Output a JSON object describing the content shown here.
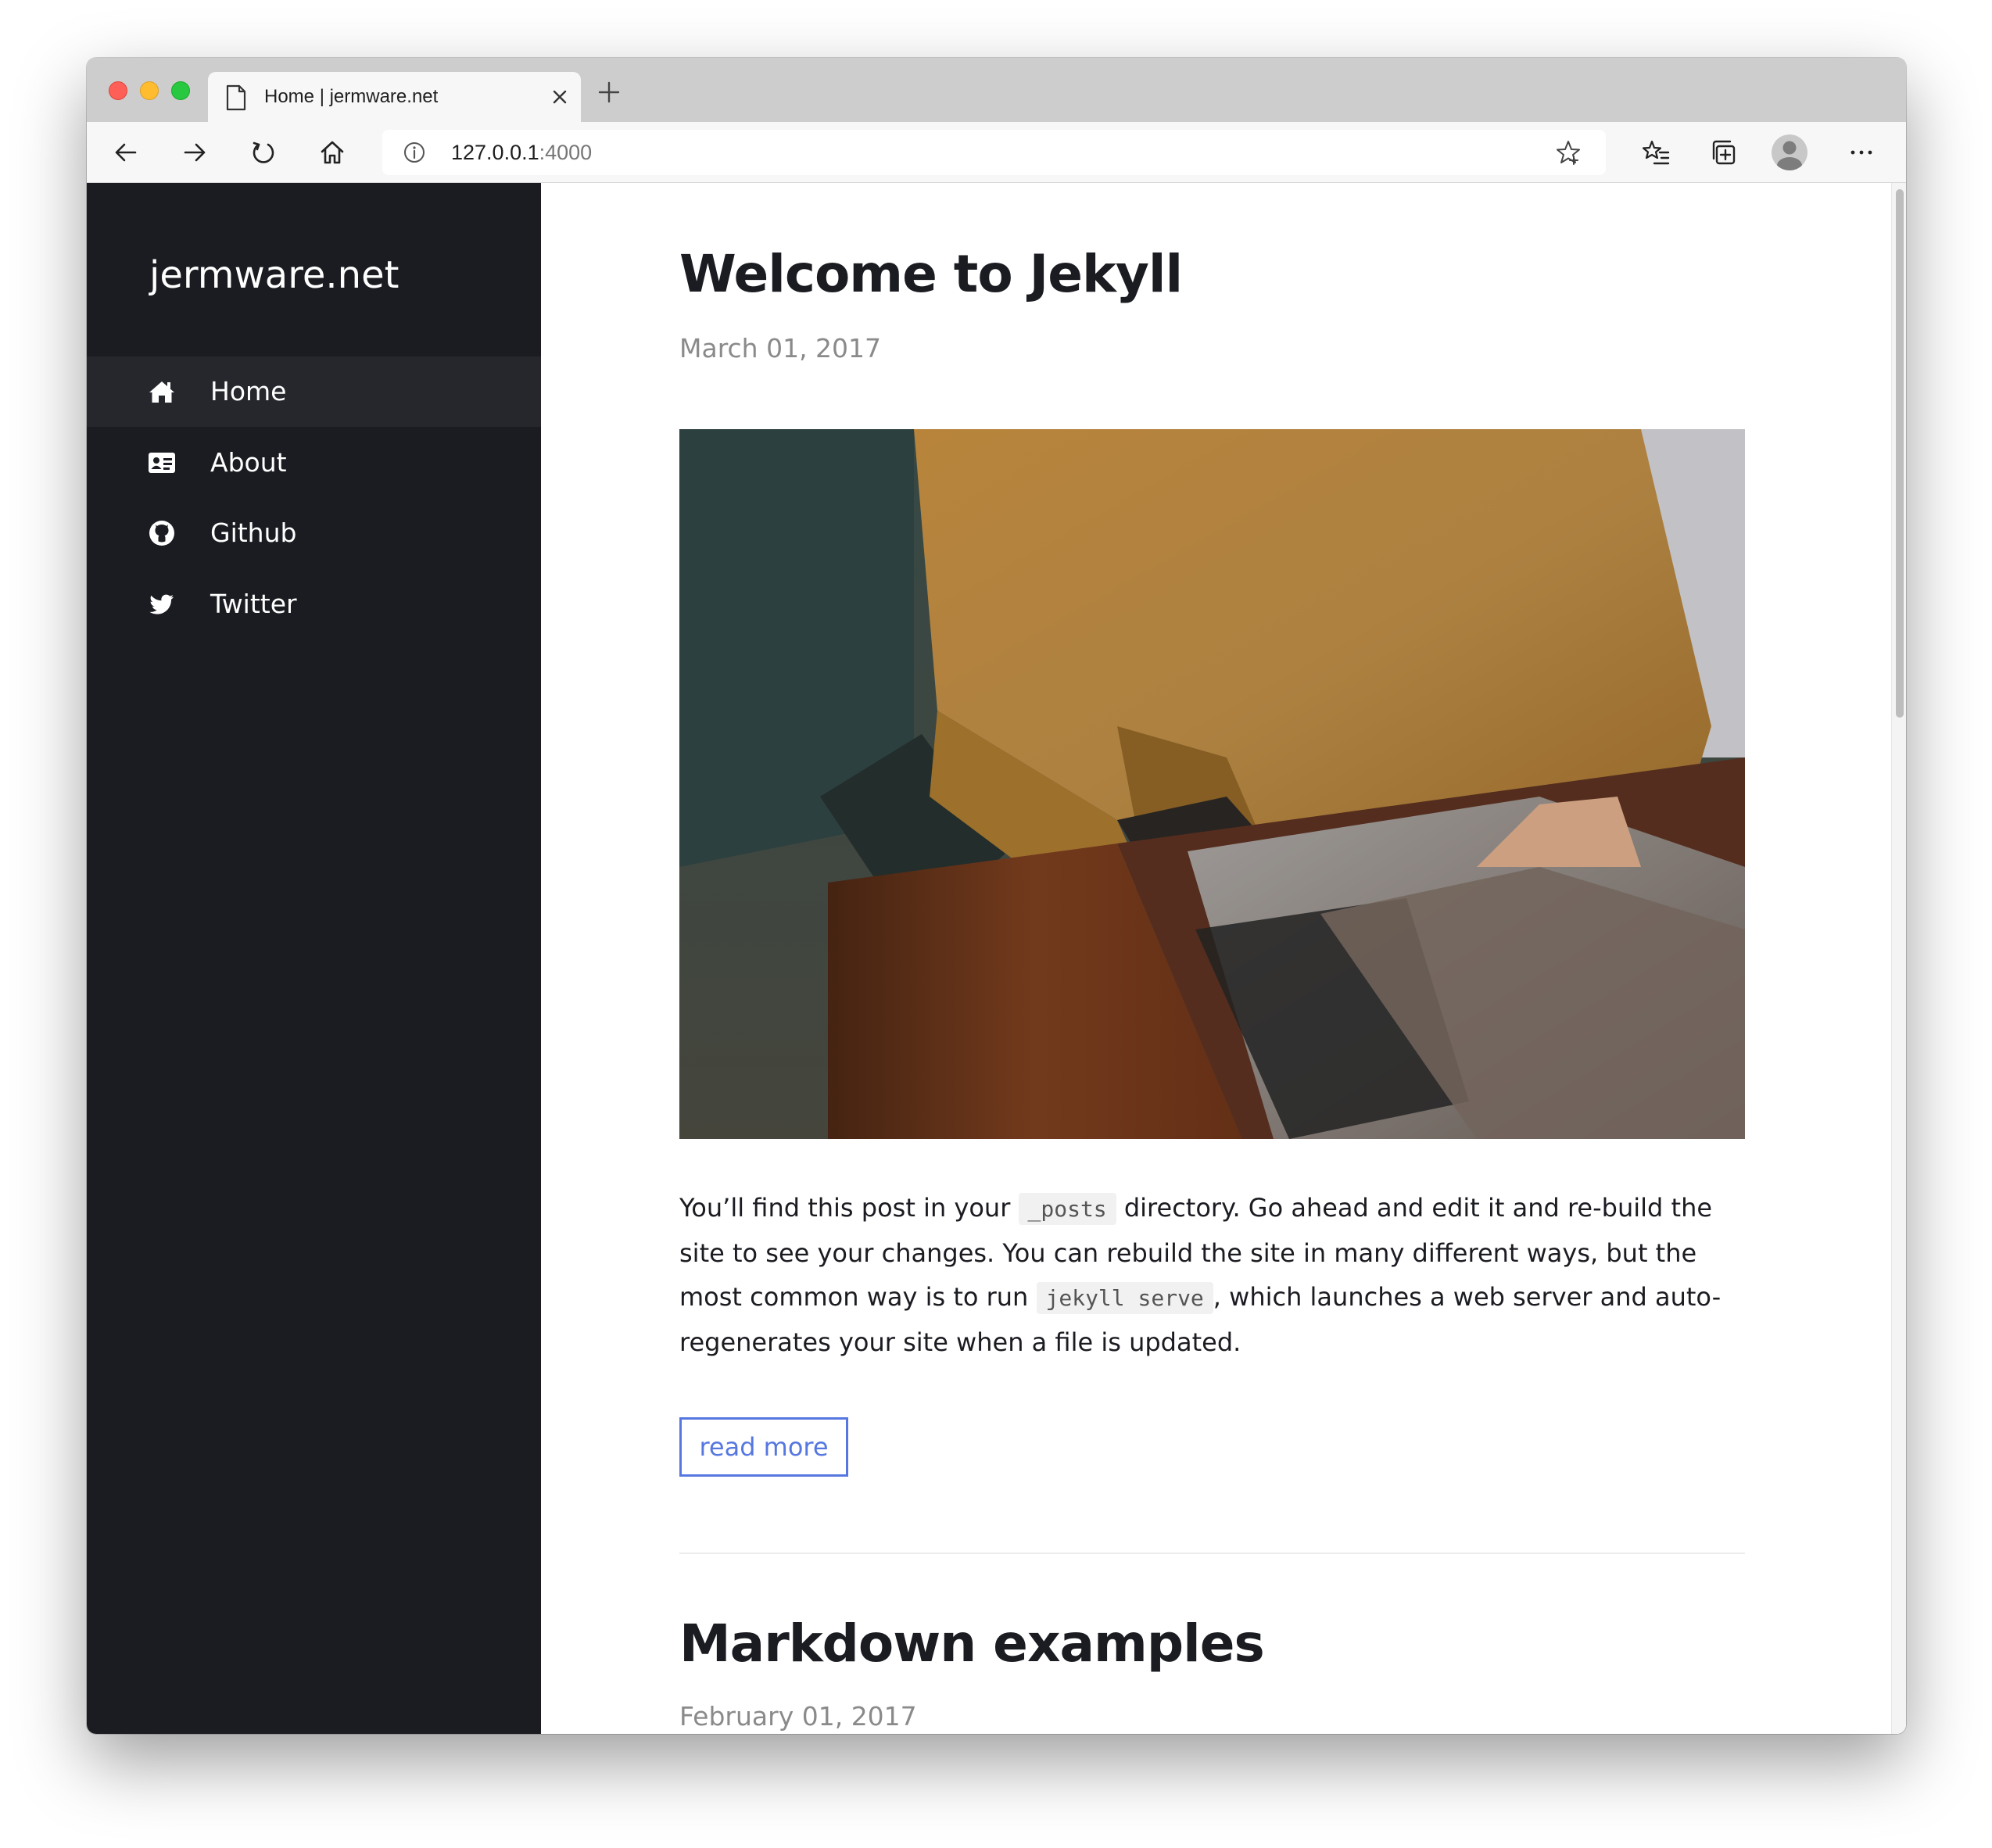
{
  "browser": {
    "tab_title": "Home | jermware.net",
    "url_host": "127.0.0.1",
    "url_port": ":4000"
  },
  "site": {
    "title": "jermware.net",
    "nav": [
      {
        "label": "Home",
        "icon": "home-icon",
        "active": true
      },
      {
        "label": "About",
        "icon": "id-card-icon",
        "active": false
      },
      {
        "label": "Github",
        "icon": "github-icon",
        "active": false
      },
      {
        "label": "Twitter",
        "icon": "twitter-icon",
        "active": false
      }
    ]
  },
  "posts": [
    {
      "title": "Welcome to Jekyll",
      "date": "March 01, 2017",
      "excerpt": {
        "p1": "You’ll find this post in your ",
        "code1": "_posts",
        "p2": " directory. Go ahead and edit it and re-build the site to see your changes. You can rebuild the site in many different ways, but the most common way is to run ",
        "code2": "jekyll serve",
        "p3": ", which launches a web server and auto-regenerates your site when a file is updated."
      },
      "read_more_label": "read more"
    },
    {
      "title": "Markdown examples",
      "date": "February 01, 2017"
    }
  ],
  "colors": {
    "sidebar_bg": "#1b1c21",
    "sidebar_active": "#26272d",
    "link": "#5677e0",
    "text": "#1b1c21",
    "date": "#8a8a8a"
  }
}
